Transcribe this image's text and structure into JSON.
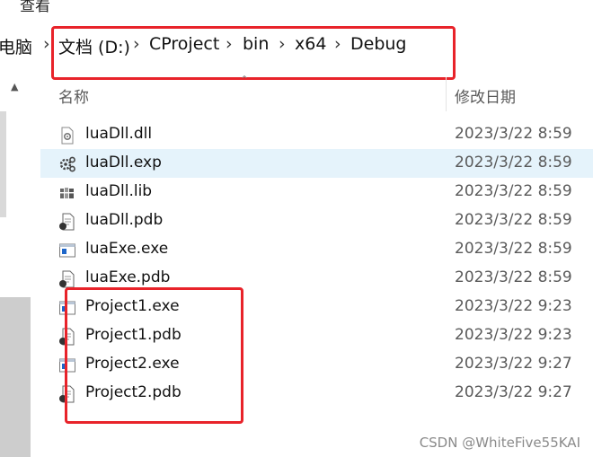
{
  "menu": {
    "view_label": "查看"
  },
  "address_bar": {
    "crumbs": [
      "电脑",
      "文档 (D:)",
      "CProject",
      "bin",
      "x64",
      "Debug"
    ],
    "separator": "›"
  },
  "columns": {
    "name": "名称",
    "date_modified": "修改日期"
  },
  "files": [
    {
      "name": "luaDll.dll",
      "date": "2023/3/22 8:59",
      "icon": "dll-file-icon",
      "selected": false
    },
    {
      "name": "luaDll.exp",
      "date": "2023/3/22 8:59",
      "icon": "exp-file-icon",
      "selected": true
    },
    {
      "name": "luaDll.lib",
      "date": "2023/3/22 8:59",
      "icon": "lib-file-icon",
      "selected": false
    },
    {
      "name": "luaDll.pdb",
      "date": "2023/3/22 8:59",
      "icon": "pdb-file-icon",
      "selected": false
    },
    {
      "name": "luaExe.exe",
      "date": "2023/3/22 8:59",
      "icon": "exe-file-icon",
      "selected": false
    },
    {
      "name": "luaExe.pdb",
      "date": "2023/3/22 8:59",
      "icon": "pdb-file-icon",
      "selected": false
    },
    {
      "name": "Project1.exe",
      "date": "2023/3/22 9:23",
      "icon": "exe-file-icon",
      "selected": false
    },
    {
      "name": "Project1.pdb",
      "date": "2023/3/22 9:23",
      "icon": "pdb-file-icon",
      "selected": false
    },
    {
      "name": "Project2.exe",
      "date": "2023/3/22 9:27",
      "icon": "exe-file-icon",
      "selected": false
    },
    {
      "name": "Project2.pdb",
      "date": "2023/3/22 9:27",
      "icon": "pdb-file-icon",
      "selected": false
    }
  ],
  "watermark": "CSDN @WhiteFive55KAI",
  "colors": {
    "annotation_red": "#e8232a",
    "selection": "#e5f3fb",
    "date_text": "#5a5a5a"
  }
}
